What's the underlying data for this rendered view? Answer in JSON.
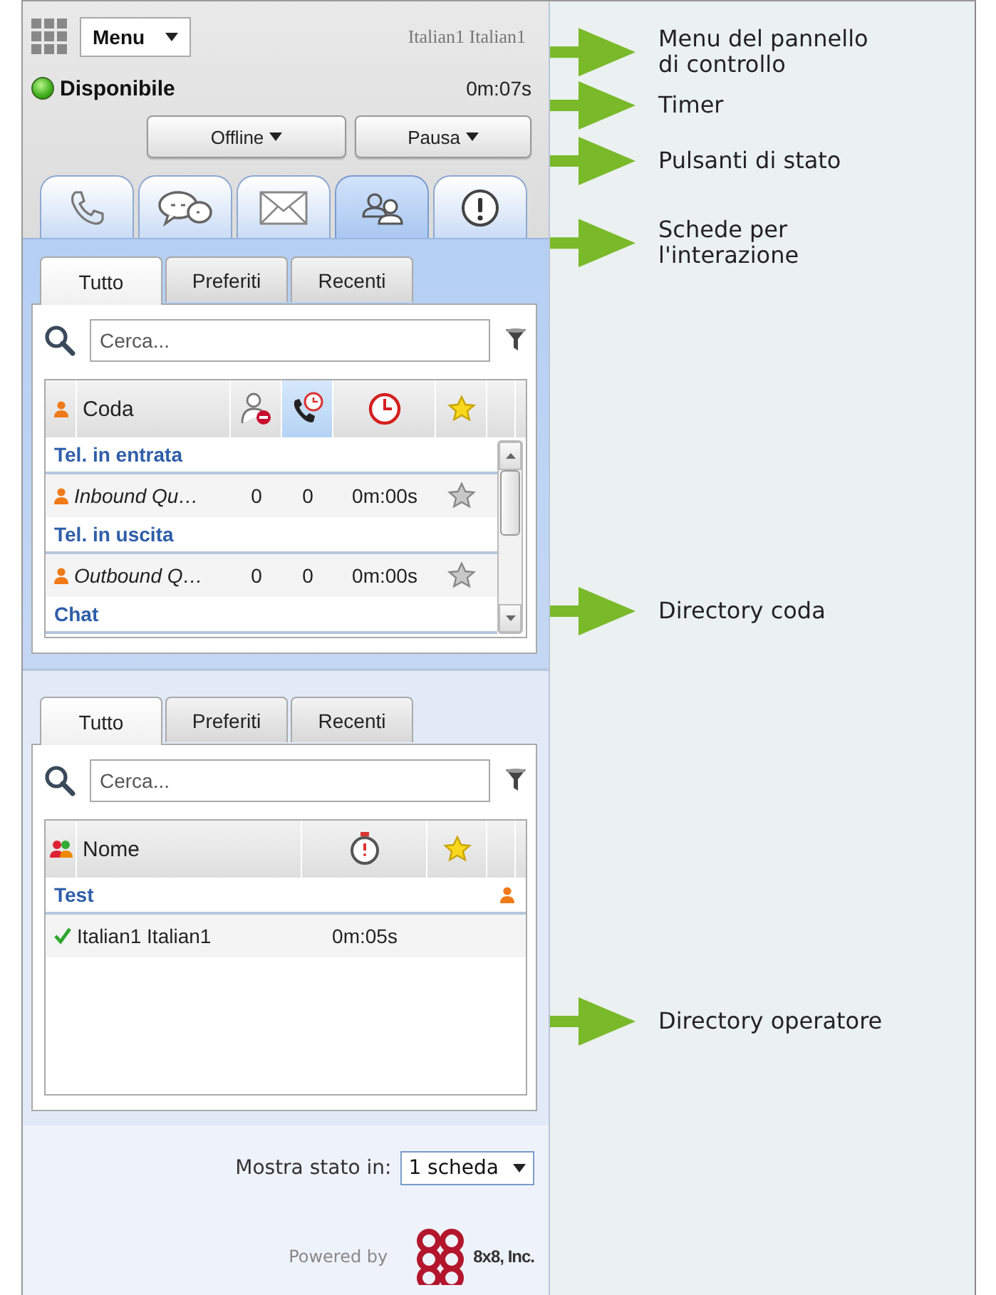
{
  "header": {
    "menu": "Menu",
    "user": "Italian1 Italian1"
  },
  "status": {
    "label": "Disponibile",
    "timer": "0m:07s"
  },
  "status_buttons": [
    "Offline",
    "Pausa"
  ],
  "interaction_tabs": [
    {
      "kind": "phone",
      "selected": false
    },
    {
      "kind": "chat",
      "selected": false
    },
    {
      "kind": "mail",
      "selected": false
    },
    {
      "kind": "contacts",
      "selected": true
    },
    {
      "kind": "alert",
      "selected": false
    }
  ],
  "queue_directory": {
    "tabs": [
      {
        "label": "Tutto",
        "selected": true
      },
      {
        "label": "Preferiti",
        "selected": false
      },
      {
        "label": "Recenti",
        "selected": false
      }
    ],
    "search": {
      "placeholder": "Cerca..."
    },
    "columns": [
      {
        "kind": "name",
        "label": "Coda",
        "sorted": false
      },
      {
        "kind": "unavailable",
        "sorted": false
      },
      {
        "kind": "waiting",
        "sorted": true
      },
      {
        "kind": "clock",
        "sorted": false
      },
      {
        "kind": "favorite",
        "sorted": false
      }
    ],
    "groups": [
      {
        "name": "Tel. in entrata",
        "rows": [
          {
            "name": "Inbound Qu…",
            "values": [
              "0",
              "0",
              "0m:00s"
            ],
            "favorite": false
          }
        ]
      },
      {
        "name": "Tel. in uscita",
        "rows": [
          {
            "name": "Outbound Q…",
            "values": [
              "0",
              "0",
              "0m:00s"
            ],
            "favorite": false
          }
        ]
      },
      {
        "name": "Chat"
      }
    ]
  },
  "agent_directory": {
    "tabs": [
      {
        "label": "Tutto",
        "selected": true
      },
      {
        "label": "Preferiti",
        "selected": false
      },
      {
        "label": "Recenti",
        "selected": false
      }
    ],
    "search": {
      "placeholder": "Cerca..."
    },
    "columns": [
      {
        "kind": "name",
        "label": "Nome"
      },
      {
        "kind": "timer"
      },
      {
        "kind": "favorite"
      }
    ],
    "groups": [
      {
        "name": "Test",
        "rows": [
          {
            "name": "Italian1 Italian1",
            "time": "0m:05s",
            "available": true
          }
        ]
      }
    ]
  },
  "footer": {
    "label": "Mostra stato in:",
    "select": "1 scheda",
    "powered_by": "Powered by",
    "company": "8x8, Inc."
  },
  "annotations": [
    "Menu del pannello\ndi controllo",
    "Timer",
    "Pulsanti di stato",
    "Schede per\nl'interazione",
    "Directory coda",
    "Directory operatore"
  ]
}
